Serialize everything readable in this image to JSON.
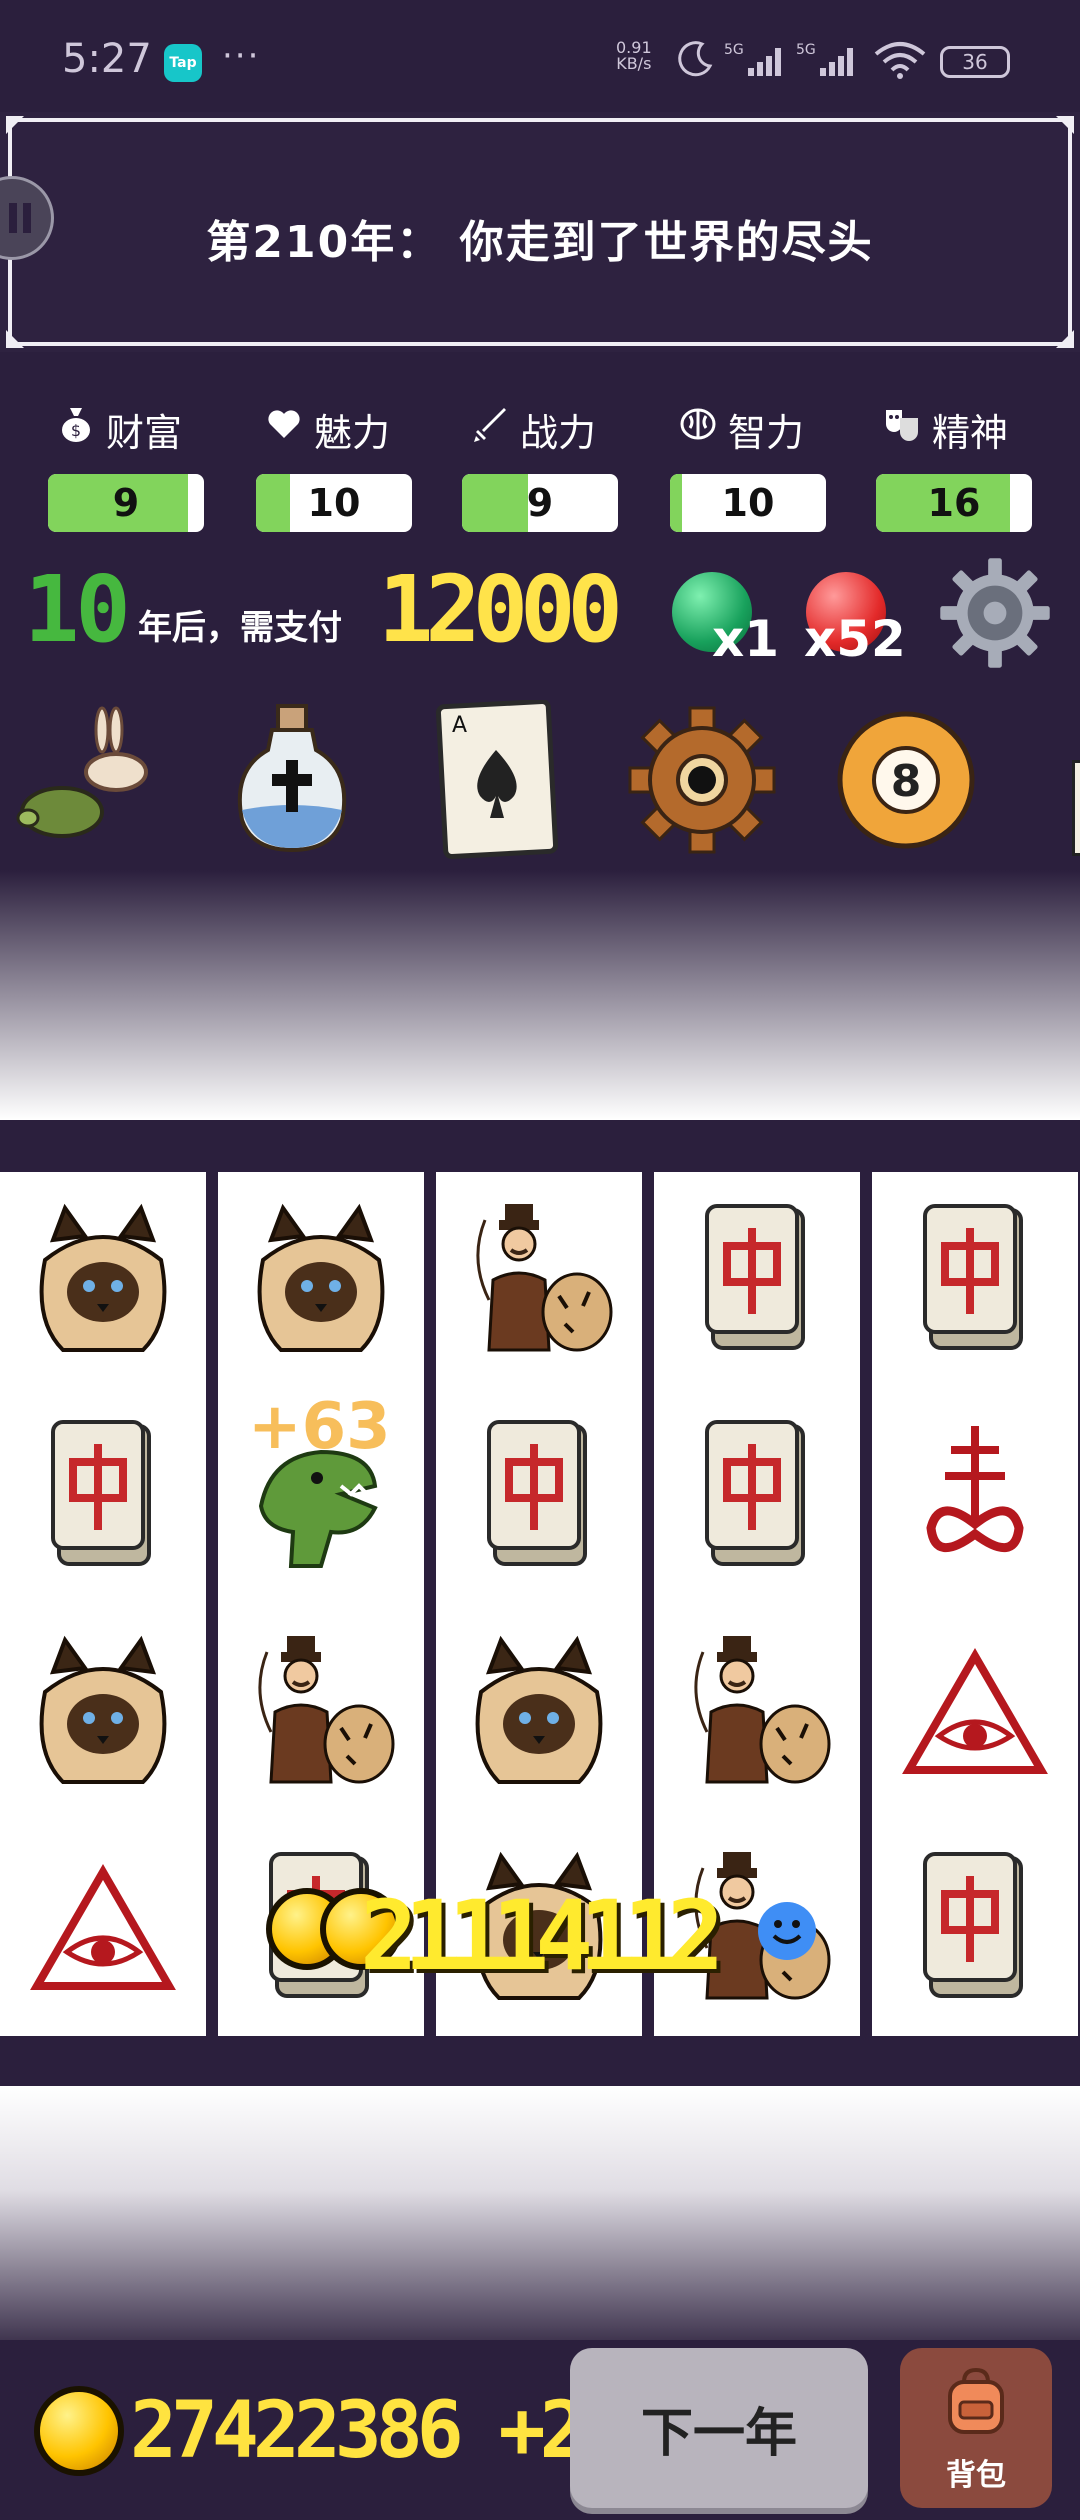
{
  "status_bar": {
    "time": "5:27",
    "tap_badge": "Tap",
    "dots": "···",
    "net_speed": "0.91",
    "net_unit": "KB/s",
    "net_type1": "5G",
    "net_type2": "5G",
    "battery": "36"
  },
  "banner": {
    "title": "第210年： 你走到了世界的尽头"
  },
  "stats": [
    {
      "label": "财富",
      "icon": "money-bag-icon",
      "value": "9",
      "fill": 0.9
    },
    {
      "label": "魅力",
      "icon": "heart-icon",
      "value": "10",
      "fill": 0.22
    },
    {
      "label": "战力",
      "icon": "sword-icon",
      "value": "9",
      "fill": 0.42
    },
    {
      "label": "智力",
      "icon": "brain-icon",
      "value": "10",
      "fill": 0.08
    },
    {
      "label": "精神",
      "icon": "mask-icon",
      "value": "16",
      "fill": 0.86
    }
  ],
  "payment": {
    "years": "10",
    "years_text": "年后，需支付",
    "amount": "12000"
  },
  "gems": {
    "green": "x1",
    "red": "x52"
  },
  "items": [
    "tortoise-and-hare-icon",
    "holy-water-bottle-icon",
    "ace-of-spades-card-icon",
    "rusty-gear-icon",
    "eight-ball-icon"
  ],
  "reels": [
    [
      "siamese-cat",
      "mahjong-zhong",
      "siamese-cat",
      "eye-of-providence"
    ],
    [
      "siamese-cat",
      "t-rex",
      "tamer-with-tiger",
      "mahjong-zhong"
    ],
    [
      "tamer-with-tiger",
      "mahjong-zhong",
      "siamese-cat",
      "siamese-cat"
    ],
    [
      "mahjong-zhong",
      "mahjong-zhong",
      "tamer-with-tiger",
      "tamer-with-tiger"
    ],
    [
      "mahjong-zhong",
      "leviathan-cross",
      "eye-of-providence",
      "mahjong-zhong"
    ]
  ],
  "bonus": "+63",
  "win_amount": "21114112",
  "gold": "27422386 +2",
  "buttons": {
    "next_year": "下一年",
    "backpack": "背包"
  },
  "colors": {
    "background": "#2b1f3d",
    "stat_fill": "#82d45c",
    "gold": "#ffe340"
  }
}
